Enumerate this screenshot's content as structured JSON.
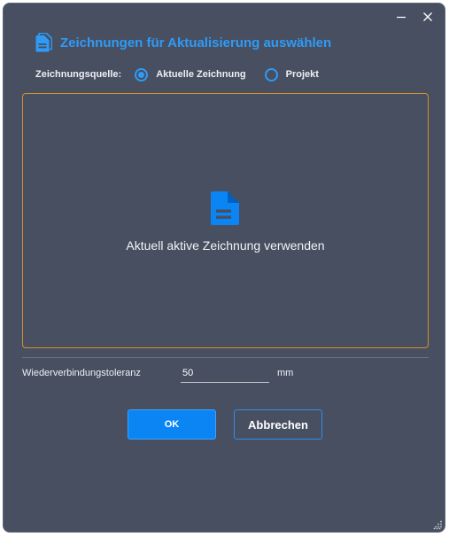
{
  "dialog": {
    "title": "Zeichnungen für Aktualisierung auswählen",
    "title_icon": "document-icon",
    "window_controls": [
      "minimize-icon",
      "close-icon"
    ]
  },
  "source": {
    "label": "Zeichnungsquelle:",
    "options": [
      {
        "label": "Aktuelle Zeichnung",
        "selected": true
      },
      {
        "label": "Projekt",
        "selected": false
      }
    ]
  },
  "drop_area": {
    "icon": "document-icon",
    "text": "Aktuell aktive Zeichnung verwenden"
  },
  "tolerance": {
    "label": "Wiederverbindungstoleranz",
    "value": "50",
    "unit": "mm"
  },
  "buttons": {
    "ok": "OK",
    "cancel": "Abbrechen"
  },
  "colors": {
    "background": "#474f61",
    "accent": "#2f9bf7",
    "primary_button": "#0b84f4",
    "drop_border": "#d4922e"
  }
}
